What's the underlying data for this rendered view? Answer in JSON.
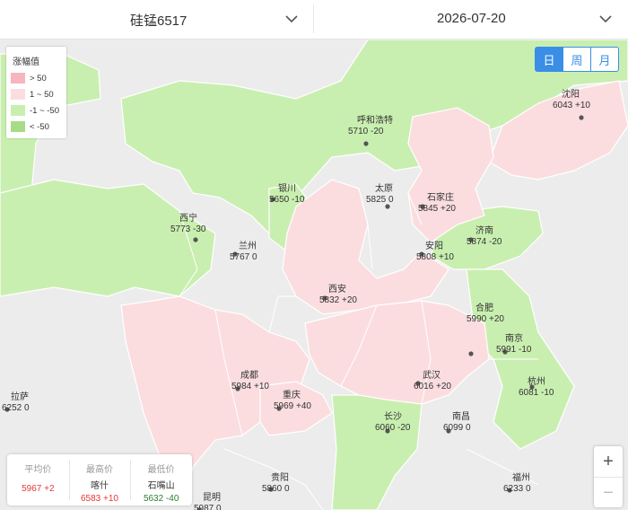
{
  "header": {
    "product": "硅锰6517",
    "date": "2026-07-20"
  },
  "legend": {
    "title": "涨幅值",
    "items": [
      {
        "label": "> 50",
        "color": "#f7b6bd"
      },
      {
        "label": "1 ~ 50",
        "color": "#fbdde0"
      },
      {
        "label": "-1 ~ -50",
        "color": "#c9efb0"
      },
      {
        "label": "< -50",
        "color": "#a6dc86"
      }
    ]
  },
  "period_buttons": [
    {
      "label": "日",
      "active": true
    },
    {
      "label": "周",
      "active": false
    },
    {
      "label": "月",
      "active": false
    }
  ],
  "colors": {
    "pink": "#fbdde0",
    "green": "#c9efb0",
    "gray": "#ececec",
    "border": "#ffffff",
    "dot": "#555555",
    "up": "#e53935",
    "down": "#2e7d32",
    "accent": "#3a8ee6"
  },
  "cities": [
    {
      "name": "呼和浩特",
      "value": "5710 -20"
    },
    {
      "name": "沈阳",
      "value": "6043 +10"
    },
    {
      "name": "银川",
      "value": "5650 -10"
    },
    {
      "name": "太原",
      "value": "5825 0"
    },
    {
      "name": "石家庄",
      "value": "5845 +20"
    },
    {
      "name": "西宁",
      "value": "5773 -30"
    },
    {
      "name": "济南",
      "value": "5874 -20"
    },
    {
      "name": "兰州",
      "value": "5767 0"
    },
    {
      "name": "安阳",
      "value": "5808 +10"
    },
    {
      "name": "西安",
      "value": "5832 +20"
    },
    {
      "name": "合肥",
      "value": "5990 +20"
    },
    {
      "name": "南京",
      "value": "5991 -10"
    },
    {
      "name": "成都",
      "value": "5984 +10"
    },
    {
      "name": "武汉",
      "value": "6016 +20"
    },
    {
      "name": "杭州",
      "value": "6081 -10"
    },
    {
      "name": "拉萨",
      "value": "6252 0"
    },
    {
      "name": "重庆",
      "value": "5969 +40"
    },
    {
      "name": "长沙",
      "value": "6060 -20"
    },
    {
      "name": "南昌",
      "value": "6099 0"
    },
    {
      "name": "贵阳",
      "value": "5860 0"
    },
    {
      "name": "福州",
      "value": "6233 0"
    },
    {
      "name": "昆明",
      "value": "5987 0"
    }
  ],
  "stats": {
    "avg_label": "平均价",
    "avg_value": "5967 +2",
    "max_label": "最高价",
    "max_city": "喀什",
    "max_value": "6583 +10",
    "min_label": "最低价",
    "min_city": "石嘴山",
    "min_value": "5632 -40"
  },
  "zoom": {
    "in": "+",
    "out": "−"
  }
}
